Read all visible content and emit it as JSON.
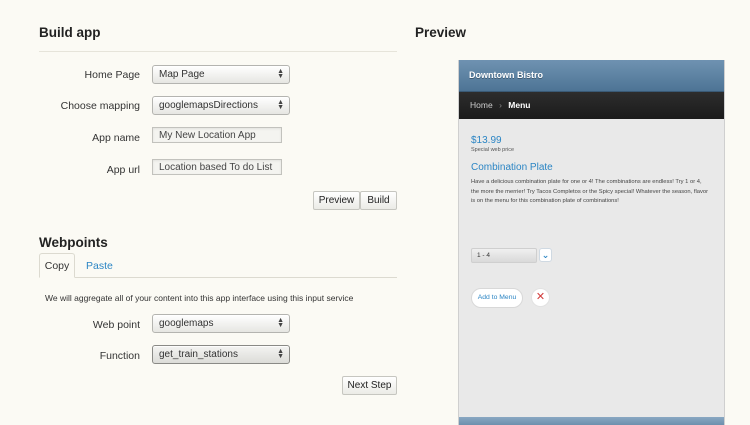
{
  "build": {
    "heading": "Build app",
    "fields": {
      "home_page": {
        "label": "Home Page",
        "value": "Map Page"
      },
      "mapping": {
        "label": "Choose mapping",
        "value": "googlemapsDirections"
      },
      "app_name": {
        "label": "App name",
        "value": "My New Location App"
      },
      "app_url": {
        "label": "App url",
        "value": "Location based To do List"
      }
    },
    "preview_button": "Preview",
    "build_button": "Build"
  },
  "webpoints": {
    "heading": "Webpoints",
    "tabs": [
      "Copy",
      "Paste"
    ],
    "description": "We will aggregate all of your content into this app interface using this input service",
    "web_point": {
      "label": "Web point",
      "value": "googlemaps"
    },
    "function": {
      "label": "Function",
      "value": "get_train_stations"
    },
    "next_button": "Next Step"
  },
  "preview": {
    "heading": "Preview",
    "app_title": "Downtown Bistro",
    "breadcrumb": {
      "home": "Home",
      "separator": "›",
      "current": "Menu"
    },
    "price": "$13.99",
    "price_note": "Special web price",
    "item_title": "Combination Plate",
    "item_desc": "Have a delicious combination plate for one or 4! The combinations are endless! Try 1 or 4, the more the merrier! Try Tacos Completos or the Spicy special! Whatever the season, flavor is on the menu for this combination plate of combinations!",
    "quantity": "1 - 4",
    "add_button": "Add to Menu",
    "colors": {
      "header": "#5c7fa0",
      "link": "#2b85c4",
      "delete": "#d23b3b"
    }
  }
}
